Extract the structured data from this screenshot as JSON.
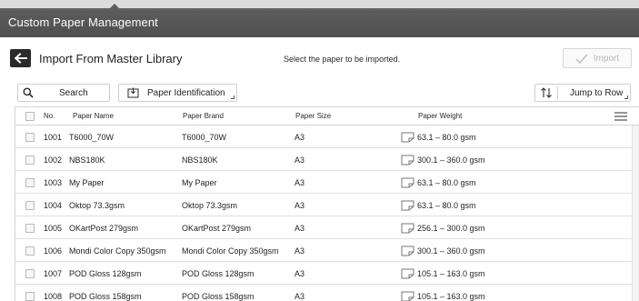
{
  "window": {
    "title": "Custom Paper Management"
  },
  "header": {
    "back_icon": "back-arrow-icon",
    "title": "Import From Master Library",
    "instruction": "Select the paper to be imported.",
    "import_label": "Import",
    "import_icon": "check-icon"
  },
  "toolbar": {
    "search_label": "Search",
    "search_icon": "search-icon",
    "paper_id_label": "Paper Identification",
    "paper_id_icon": "paper-identification-icon",
    "jump_label": "Jump to Row",
    "jump_icon": "sort-arrows-icon"
  },
  "table": {
    "columns": [
      "No.",
      "Paper Name",
      "Paper Brand",
      "Paper Size",
      "Paper Weight"
    ],
    "menu_icon": "hamburger-menu-icon",
    "rows": [
      {
        "no": "1001",
        "name": "T6000_70W",
        "brand": "T6000_70W",
        "size": "A3",
        "weight": "63.1 – 80.0 gsm"
      },
      {
        "no": "1002",
        "name": "NBS180K",
        "brand": "NBS180K",
        "size": "A3",
        "weight": "300.1 – 360.0 gsm"
      },
      {
        "no": "1003",
        "name": "My Paper",
        "brand": "My Paper",
        "size": "A3",
        "weight": "63.1 – 80.0 gsm"
      },
      {
        "no": "1004",
        "name": "Oktop 73.3gsm",
        "brand": "Oktop 73.3gsm",
        "size": "A3",
        "weight": "63.1 – 80.0 gsm"
      },
      {
        "no": "1005",
        "name": "OKartPost 279gsm",
        "brand": "OKartPost 279gsm",
        "size": "A3",
        "weight": "256.1 – 300.0 gsm"
      },
      {
        "no": "1006",
        "name": "Mondi Color Copy 350gsm",
        "brand": "Mondi Color Copy 350gsm",
        "size": "A3",
        "weight": "300.1 – 360.0 gsm"
      },
      {
        "no": "1007",
        "name": "POD Gloss 128gsm",
        "brand": "POD Gloss 128gsm",
        "size": "A3",
        "weight": "105.1 – 163.0 gsm"
      },
      {
        "no": "1008",
        "name": "POD Gloss 158gsm",
        "brand": "POD Gloss 158gsm",
        "size": "A3",
        "weight": "105.1 – 163.0 gsm"
      }
    ]
  }
}
